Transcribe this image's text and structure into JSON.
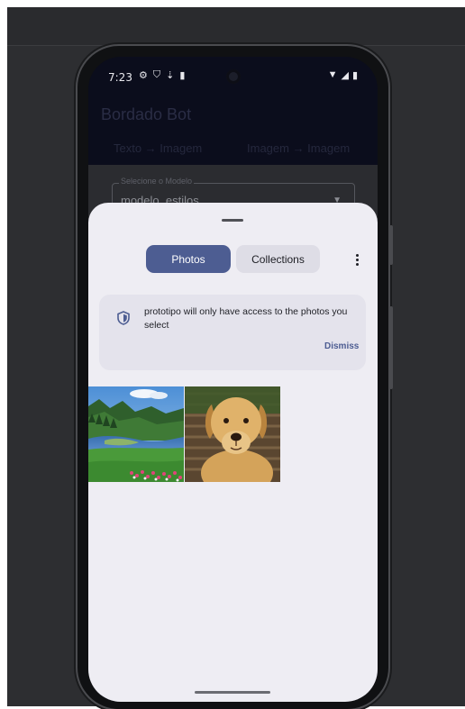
{
  "status_bar": {
    "time": "7:23"
  },
  "app": {
    "title": "Bordado Bot",
    "tabs": [
      {
        "label": "Texto → Imagem"
      },
      {
        "label": "Imagem → Imagem"
      }
    ],
    "model_select": {
      "label": "Selecione o Modelo",
      "value": "modelo_estilos"
    }
  },
  "picker": {
    "tabs": {
      "photos": "Photos",
      "collections": "Collections"
    },
    "notice": {
      "text": "prototipo will only have access to the photos you select",
      "dismiss": "Dismiss"
    },
    "photos": [
      {
        "subject": "landscape"
      },
      {
        "subject": "dog"
      }
    ]
  },
  "colors": {
    "accent": "#4d5d92",
    "sheet_background": "#eeedf3",
    "notice_background": "#e4e3ec",
    "app_background": "#0b0d1c"
  },
  "icons": [
    "settings-icon",
    "shield-icon",
    "download-icon",
    "sd-card-icon",
    "wifi-icon",
    "signal-icon",
    "battery-icon",
    "more-vert-icon"
  ]
}
